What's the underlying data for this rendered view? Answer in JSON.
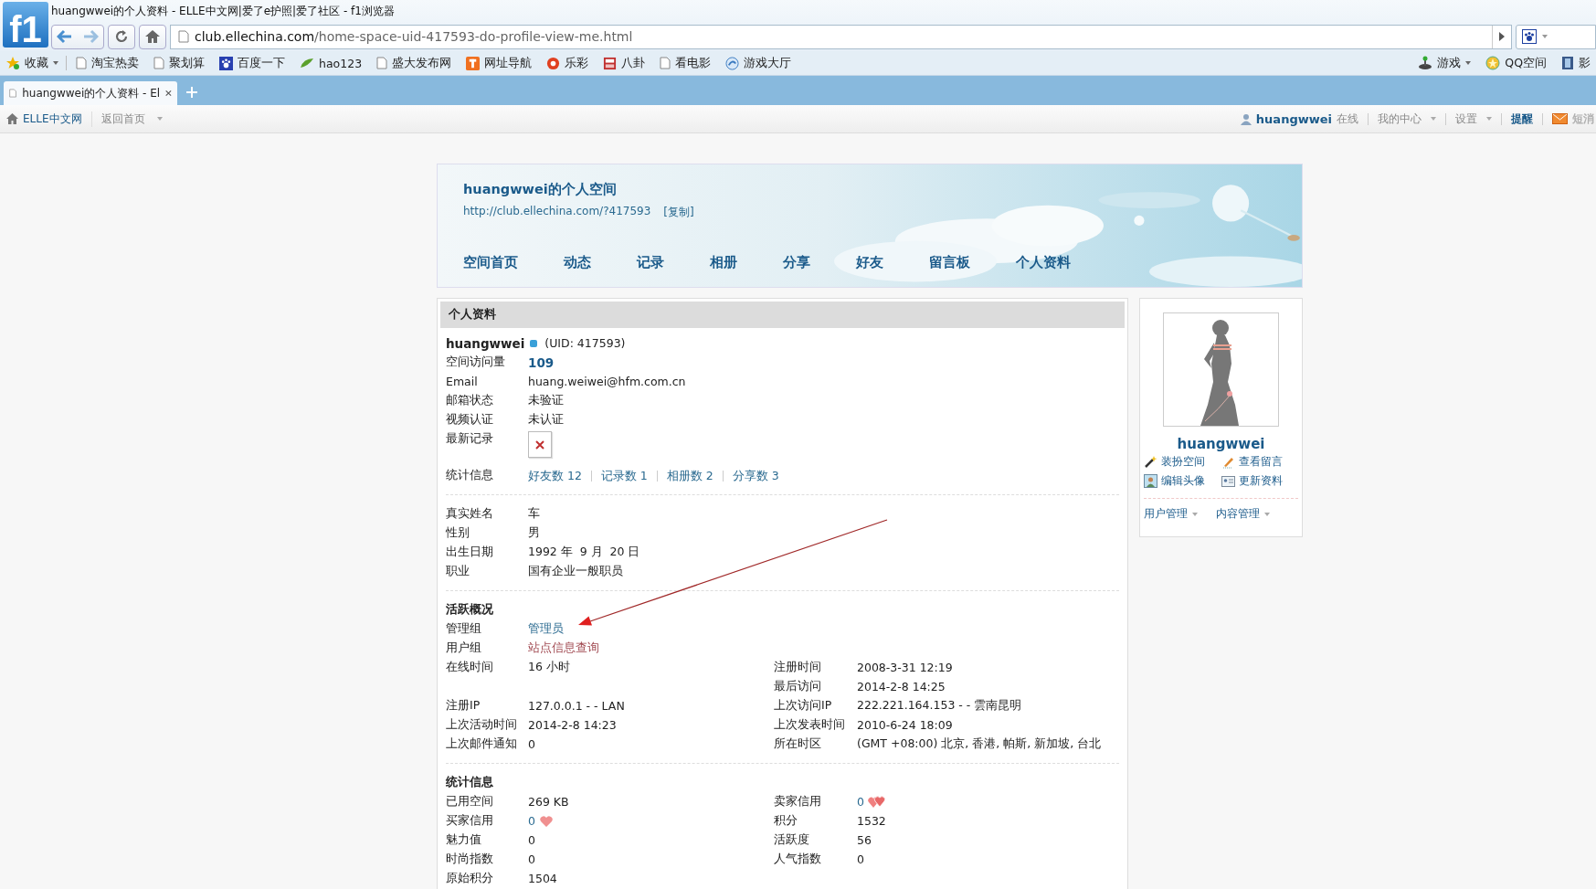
{
  "browser": {
    "title": "huangwwei的个人资料 - ELLE中文网|爱了e护照|爱了社区 - f1浏览器",
    "logo": "f1",
    "url_host": "club.ellechina.com",
    "url_path": "/home-space-uid-417593-do-profile-view-me.html",
    "bookmarks": [
      {
        "label": "收藏",
        "kind": "favorites"
      },
      {
        "label": "淘宝热卖",
        "kind": "page"
      },
      {
        "label": "聚划算",
        "kind": "page"
      },
      {
        "label": "百度一下",
        "kind": "paw"
      },
      {
        "label": "hao123",
        "kind": "leaf"
      },
      {
        "label": "盛大发布网",
        "kind": "page"
      },
      {
        "label": "网址导航",
        "kind": "orange"
      },
      {
        "label": "乐彩",
        "kind": "lottery"
      },
      {
        "label": "八卦",
        "kind": "gossip"
      },
      {
        "label": "看电影",
        "kind": "page"
      },
      {
        "label": "游戏大厅",
        "kind": "hall"
      }
    ],
    "bookmarks_right": [
      {
        "label": "游戏",
        "kind": "joystick"
      },
      {
        "label": "QQ空间",
        "kind": "star"
      },
      {
        "label": "影",
        "kind": "film"
      }
    ],
    "tabs": [
      {
        "label": "huangwwei的个人资料 - El",
        "selected": true
      }
    ]
  },
  "site_bar": {
    "home": "ELLE中文网",
    "back": "返回首页",
    "user": "huangwwei",
    "status": "在线",
    "menus": [
      "我的中心",
      "设置"
    ],
    "remind": "提醒",
    "messages": "短消"
  },
  "space": {
    "title": "huangwwei的个人空间",
    "url": "http://club.ellechina.com/?417593",
    "copy": "[复制]",
    "nav": [
      "空间首页",
      "动态",
      "记录",
      "相册",
      "分享",
      "好友",
      "留言板",
      "个人资料"
    ]
  },
  "profile": {
    "header": "个人资料",
    "username": "huangwwei",
    "uid": "(UID: 417593)",
    "basic": [
      {
        "label": "空间访问量",
        "value": "109",
        "kind": "count"
      },
      {
        "label": "Email",
        "value": "huang.weiwei@hfm.com.cn",
        "kind": "text"
      },
      {
        "label": "邮箱状态",
        "value": "未验证",
        "kind": "text"
      },
      {
        "label": "视频认证",
        "value": "未认证",
        "kind": "text"
      },
      {
        "label": "最新记录",
        "kind": "broken-image"
      },
      {
        "label": "统计信息",
        "kind": "stats",
        "links": [
          "好友数 12",
          "记录数 1",
          "相册数 2",
          "分享数 3"
        ]
      }
    ],
    "personal": [
      {
        "label": "真实姓名",
        "value": "车"
      },
      {
        "label": "性别",
        "value": "男"
      },
      {
        "label": "出生日期",
        "value": "1992 年  9 月  20 日"
      },
      {
        "label": "职业",
        "value": "国有企业一般职员"
      }
    ],
    "sections": [
      {
        "title": "活跃概况",
        "rows": [
          {
            "left": {
              "label": "管理组",
              "value": "管理员",
              "kind": "link"
            }
          },
          {
            "left": {
              "label": "用户组",
              "value": "站点信息查询",
              "kind": "group"
            }
          },
          {
            "left": {
              "label": "在线时间",
              "value": "16 小时",
              "kind": "text"
            },
            "right": {
              "label": "注册时间",
              "value": "2008-3-31 12:19",
              "kind": "text"
            }
          },
          {
            "right": {
              "label": "最后访问",
              "value": "2014-2-8 14:25",
              "kind": "text"
            }
          },
          {
            "left": {
              "label": "注册IP",
              "value": "127.0.0.1 - - LAN",
              "kind": "text"
            },
            "right": {
              "label": "上次访问IP",
              "value": "222.221.164.153 - - 雲南昆明",
              "kind": "text"
            }
          },
          {
            "left": {
              "label": "上次活动时间",
              "value": "2014-2-8 14:23",
              "kind": "text"
            },
            "right": {
              "label": "上次发表时间",
              "value": "2010-6-24 18:09",
              "kind": "text"
            }
          },
          {
            "left": {
              "label": "上次邮件通知",
              "value": "0",
              "kind": "text"
            },
            "right": {
              "label": "所在时区",
              "value": "(GMT +08:00) 北京, 香港, 帕斯, 新加坡, 台北",
              "kind": "text"
            }
          }
        ]
      },
      {
        "title": "统计信息",
        "rows": [
          {
            "left": {
              "label": "已用空间",
              "value": "269 KB",
              "kind": "text"
            },
            "right": {
              "label": "卖家信用",
              "value": "0",
              "kind": "seller-credit"
            }
          },
          {
            "left": {
              "label": "买家信用",
              "value": "0",
              "kind": "buyer-credit"
            },
            "right": {
              "label": "积分",
              "value": "1532",
              "kind": "text"
            }
          },
          {
            "left": {
              "label": "魅力值",
              "value": "0",
              "kind": "text"
            },
            "right": {
              "label": "活跃度",
              "value": "56",
              "kind": "text"
            }
          },
          {
            "left": {
              "label": "时尚指数",
              "value": "0",
              "kind": "text"
            },
            "right": {
              "label": "人气指数",
              "value": "0",
              "kind": "text"
            }
          },
          {
            "left": {
              "label": "原始积分",
              "value": "1504",
              "kind": "text"
            }
          }
        ]
      }
    ]
  },
  "sidebar": {
    "name": "huangwwei",
    "actions": [
      {
        "label": "装扮空间",
        "kind": "wand"
      },
      {
        "label": "查看留言",
        "kind": "pencil"
      },
      {
        "label": "编辑头像",
        "kind": "portrait"
      },
      {
        "label": "更新资料",
        "kind": "card"
      }
    ],
    "menus": [
      "用户管理",
      "内容管理"
    ]
  }
}
